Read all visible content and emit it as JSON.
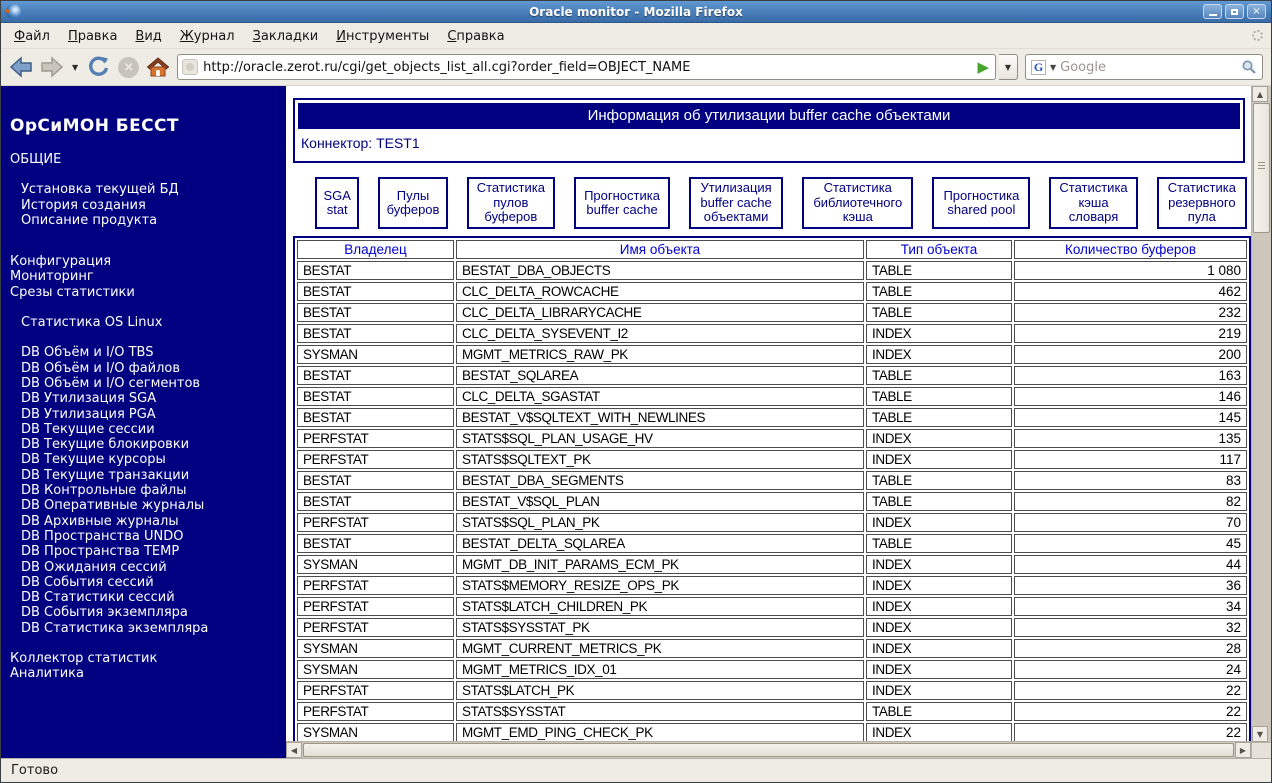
{
  "window": {
    "title": "Oracle monitor - Mozilla Firefox"
  },
  "menu": {
    "items": [
      "Файл",
      "Правка",
      "Вид",
      "Журнал",
      "Закладки",
      "Инструменты",
      "Справка"
    ]
  },
  "toolbar": {
    "url": "http://oracle.zerot.ru/cgi/get_objects_list_all.cgi?order_field=OBJECT_NAME",
    "search_placeholder": "Google",
    "search_engine_letter": "G"
  },
  "icons": {
    "dropdown": "▼",
    "go": "▶",
    "up": "▲",
    "down": "▼",
    "left": "◀",
    "right": "▶",
    "close": "×",
    "stop": "×"
  },
  "colors": {
    "navy": "#000080",
    "header_link": "#0000cc",
    "titlebar_blue": "#4c82bd",
    "chrome_bg": "#efebe5",
    "go_green": "#44a62c"
  },
  "sidebar": {
    "title": "ОрСиМОН БЕССТ",
    "items": [
      {
        "label": "ОБЩИЕ",
        "indent": 0
      },
      {
        "label": "Установка текущей БД",
        "indent": 1,
        "gap": "sm"
      },
      {
        "label": "История создания",
        "indent": 1
      },
      {
        "label": "Описание продукта",
        "indent": 1
      },
      {
        "label": "Конфигурация",
        "indent": 0,
        "gap": "lg"
      },
      {
        "label": "Мониторинг",
        "indent": 0
      },
      {
        "label": "Срезы статистики",
        "indent": 0
      },
      {
        "label": "Статистика OS Linux",
        "indent": 1,
        "gap": "sm"
      },
      {
        "label": "DB Объём и I/O TBS",
        "indent": 1,
        "gap": "sm"
      },
      {
        "label": "DB Объём и I/O файлов",
        "indent": 1
      },
      {
        "label": "DB Объём и I/O сегментов",
        "indent": 1
      },
      {
        "label": "DB Утилизация SGA",
        "indent": 1
      },
      {
        "label": "DB Утилизация PGA",
        "indent": 1
      },
      {
        "label": "DB Текущие сессии",
        "indent": 1
      },
      {
        "label": "DB Текущие блокировки",
        "indent": 1
      },
      {
        "label": "DB Текущие курсоры",
        "indent": 1
      },
      {
        "label": "DB Текущие транзакции",
        "indent": 1
      },
      {
        "label": "DB Контрольные файлы",
        "indent": 1
      },
      {
        "label": "DB Оперативные журналы",
        "indent": 1
      },
      {
        "label": "DB Архивные журналы",
        "indent": 1
      },
      {
        "label": "DB Пространства UNDO",
        "indent": 1
      },
      {
        "label": "DB Пространства TEMP",
        "indent": 1
      },
      {
        "label": "DB Ожидания сессий",
        "indent": 1
      },
      {
        "label": "DB События сессий",
        "indent": 1
      },
      {
        "label": "DB Статистики сессий",
        "indent": 1
      },
      {
        "label": "DB События экземпляра",
        "indent": 1
      },
      {
        "label": "DB Статистика экземпляра",
        "indent": 1
      },
      {
        "label": "Коллектор статистик",
        "indent": 0,
        "gap": "sm"
      },
      {
        "label": "Аналитика",
        "indent": 0
      }
    ]
  },
  "page": {
    "header_title": "Информация об утилизации buffer cache объектами",
    "connector_label": "Коннектор: TEST1",
    "tabs": [
      "SGA stat",
      "Пулы буферов",
      "Статистика пулов буферов",
      "Прогностика buffer cache",
      "Утилизация buffer cache объектами",
      "Статистика библиотечного кэша",
      "Прогностика shared pool",
      "Статистика кэша словаря",
      "Статистика резервного пула"
    ],
    "table": {
      "headers": [
        "Владелец",
        "Имя объекта",
        "Тип объекта",
        "Количество буферов"
      ],
      "rows": [
        [
          "BESTAT",
          "BESTAT_DBA_OBJECTS",
          "TABLE",
          "1 080"
        ],
        [
          "BESTAT",
          "CLC_DELTA_ROWCACHE",
          "TABLE",
          "462"
        ],
        [
          "BESTAT",
          "CLC_DELTA_LIBRARYCACHE",
          "TABLE",
          "232"
        ],
        [
          "BESTAT",
          "CLC_DELTA_SYSEVENT_I2",
          "INDEX",
          "219"
        ],
        [
          "SYSMAN",
          "MGMT_METRICS_RAW_PK",
          "INDEX",
          "200"
        ],
        [
          "BESTAT",
          "BESTAT_SQLAREA",
          "TABLE",
          "163"
        ],
        [
          "BESTAT",
          "CLC_DELTA_SGASTAT",
          "TABLE",
          "146"
        ],
        [
          "BESTAT",
          "BESTAT_V$SQLTEXT_WITH_NEWLINES",
          "TABLE",
          "145"
        ],
        [
          "PERFSTAT",
          "STATS$SQL_PLAN_USAGE_HV",
          "INDEX",
          "135"
        ],
        [
          "PERFSTAT",
          "STATS$SQLTEXT_PK",
          "INDEX",
          "117"
        ],
        [
          "BESTAT",
          "BESTAT_DBA_SEGMENTS",
          "TABLE",
          "83"
        ],
        [
          "BESTAT",
          "BESTAT_V$SQL_PLAN",
          "TABLE",
          "82"
        ],
        [
          "PERFSTAT",
          "STATS$SQL_PLAN_PK",
          "INDEX",
          "70"
        ],
        [
          "BESTAT",
          "BESTAT_DELTA_SQLAREA",
          "TABLE",
          "45"
        ],
        [
          "SYSMAN",
          "MGMT_DB_INIT_PARAMS_ECM_PK",
          "INDEX",
          "44"
        ],
        [
          "PERFSTAT",
          "STATS$MEMORY_RESIZE_OPS_PK",
          "INDEX",
          "36"
        ],
        [
          "PERFSTAT",
          "STATS$LATCH_CHILDREN_PK",
          "INDEX",
          "34"
        ],
        [
          "PERFSTAT",
          "STATS$SYSSTAT_PK",
          "INDEX",
          "32"
        ],
        [
          "SYSMAN",
          "MGMT_CURRENT_METRICS_PK",
          "INDEX",
          "28"
        ],
        [
          "SYSMAN",
          "MGMT_METRICS_IDX_01",
          "INDEX",
          "24"
        ],
        [
          "PERFSTAT",
          "STATS$LATCH_PK",
          "INDEX",
          "22"
        ],
        [
          "PERFSTAT",
          "STATS$SYSSTAT",
          "TABLE",
          "22"
        ],
        [
          "SYSMAN",
          "MGMT_EMD_PING_CHECK_PK",
          "INDEX",
          "22"
        ]
      ]
    }
  },
  "statusbar": {
    "text": "Готово"
  }
}
